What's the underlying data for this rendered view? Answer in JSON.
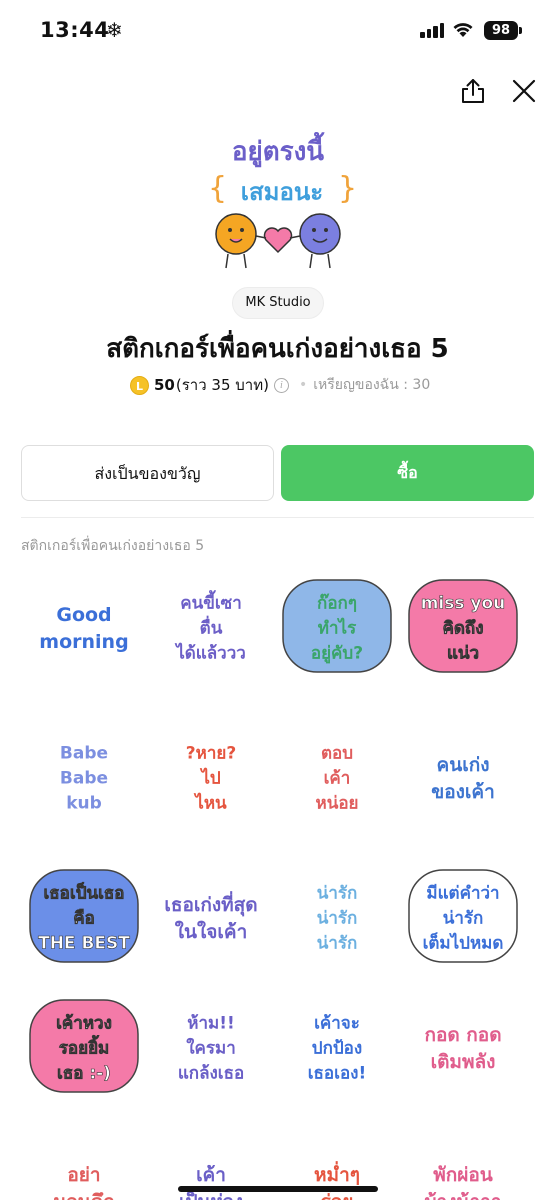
{
  "status_bar": {
    "time": "13:44",
    "extra_icon": "❄",
    "battery": "98"
  },
  "header": {
    "share_icon": "share-icon",
    "close_icon": "close-icon"
  },
  "product": {
    "main_sticker_lines": [
      "อยู่ตรงนี้",
      "เสมอนะ"
    ],
    "studio": "MK Studio",
    "title": "สติกเกอร์เพื่อคนเก่งอย่างเธอ 5",
    "coin_symbol": "L",
    "price": "50",
    "price_baht": "(ราว 35 บาท)",
    "info_icon": "i",
    "my_coins": "เหรียญของฉัน : 30"
  },
  "actions": {
    "gift_label": "ส่งเป็นของขวัญ",
    "buy_label": "ซื้อ"
  },
  "section": {
    "label": "สติกเกอร์เพื่อคนเก่งอย่างเธอ 5"
  },
  "stickers": [
    {
      "lines": [
        "Good",
        "morning"
      ],
      "color": "#3b6fd8",
      "bg": "none"
    },
    {
      "lines": [
        "คนขี้เซา",
        "ตื่น",
        "ได้แล้ววว"
      ],
      "color": "#6c5fc7",
      "bg": "none"
    },
    {
      "lines": [
        "ก๊อกๆ",
        "ทำไร",
        "อยู่คับ?"
      ],
      "color": "#3aa56a",
      "bg": "#8fb7e8"
    },
    {
      "lines": [
        "miss you",
        "คิดถึง",
        "แน่ว"
      ],
      "color": "#ffffff",
      "bg": "#f47aa8"
    },
    {
      "lines": [
        "Babe",
        "Babe",
        "kub"
      ],
      "color": "#7c8fe0",
      "bg": "none"
    },
    {
      "lines": [
        "?หาย?",
        "ไป",
        "ไหน"
      ],
      "color": "#e5553f",
      "bg": "none"
    },
    {
      "lines": [
        "ตอบ",
        "เค้า",
        "หน่อย"
      ],
      "color": "#e05d5d",
      "bg": "none"
    },
    {
      "lines": [
        "คนเก่ง",
        "ของเค้า"
      ],
      "color": "#3d74cf",
      "bg": "none"
    },
    {
      "lines": [
        "เธอเป็นเธอ",
        "คือ",
        "THE BEST"
      ],
      "color": "#ffffff",
      "bg": "#6b8fe8"
    },
    {
      "lines": [
        "เธอเก่งที่สุด",
        "ในใจเค้า"
      ],
      "color": "#6a5fc7",
      "bg": "none"
    },
    {
      "lines": [
        "น่ารัก",
        "น่ารัก",
        "น่ารัก"
      ],
      "color": "#6cb0e0",
      "bg": "none"
    },
    {
      "lines": [
        "มีแต่คำว่า",
        "น่ารัก",
        "เต็มไปหมด"
      ],
      "color": "#3b6fd8",
      "bg": "#ffffff"
    },
    {
      "lines": [
        "เค้าหวง",
        "รอยยิ้ม",
        "เธอ :-)"
      ],
      "color": "#ffffff",
      "bg": "#f47aa8"
    },
    {
      "lines": [
        "ห้าม!!",
        "ใครมา",
        "แกล้งเธอ"
      ],
      "color": "#6a5fc7",
      "bg": "none"
    },
    {
      "lines": [
        "เค้าจะ",
        "ปกป้อง",
        "เธอเอง!"
      ],
      "color": "#3b6fd8",
      "bg": "none"
    },
    {
      "lines": [
        "กอด กอด",
        "เติมพลัง"
      ],
      "color": "#e05d8c",
      "bg": "none"
    },
    {
      "lines": [
        "อย่า",
        "นอนดึก"
      ],
      "color": "#e05d5d",
      "bg": "none"
    },
    {
      "lines": [
        "เค้า",
        "เป็นห่วง"
      ],
      "color": "#6a5fc7",
      "bg": "none"
    },
    {
      "lines": [
        "หม่ำๆ",
        "ร่ือย"
      ],
      "color": "#e5553f",
      "bg": "none"
    },
    {
      "lines": [
        "พักผ่อน",
        "บ้างน้าาา"
      ],
      "color": "#e05d8c",
      "bg": "none"
    }
  ]
}
